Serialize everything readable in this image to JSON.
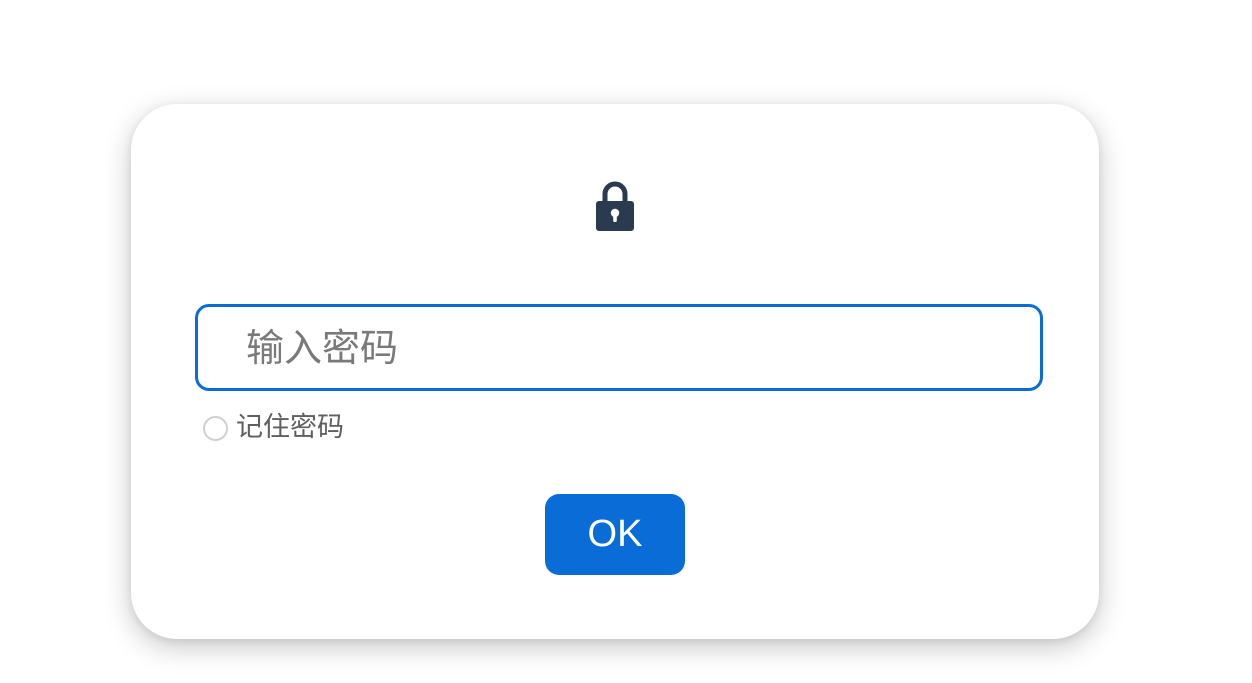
{
  "dialog": {
    "lock_icon": "lock-icon",
    "password": {
      "placeholder": "输入密码",
      "value": ""
    },
    "remember": {
      "label": "记住密码",
      "checked": false
    },
    "ok_label": "OK"
  },
  "colors": {
    "accent": "#0a6cd6",
    "icon": "#2a3a4f",
    "placeholder": "#7a7a7a",
    "label": "#5f5f5f",
    "radio_border": "#d0d0d0"
  }
}
